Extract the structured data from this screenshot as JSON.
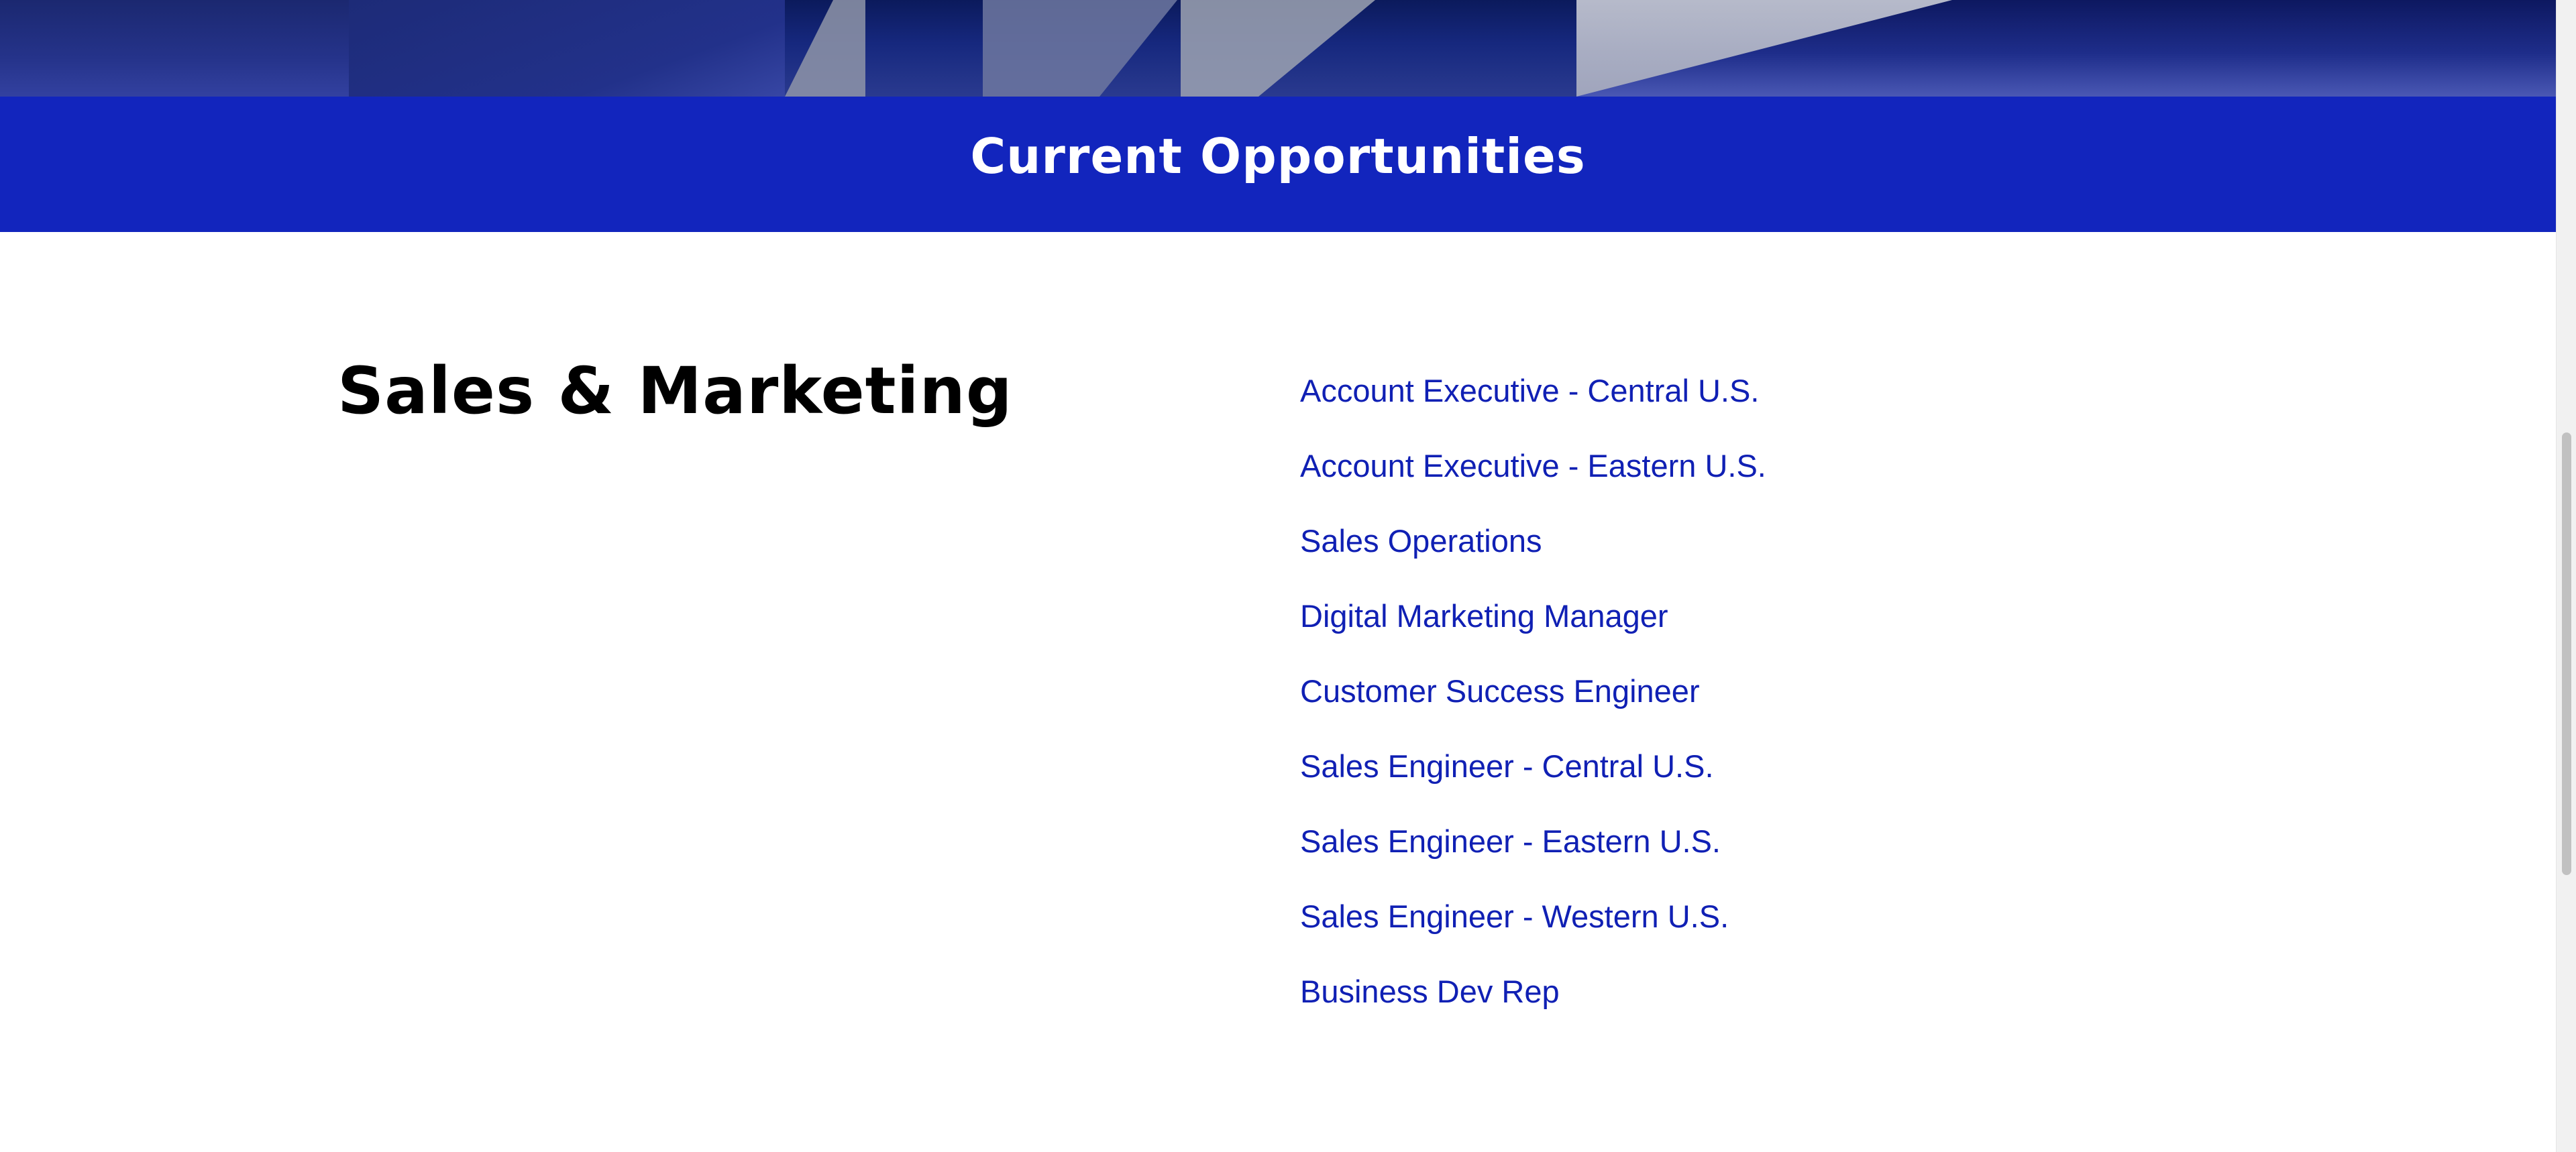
{
  "banner": {
    "title": "Current Opportunities"
  },
  "section": {
    "title": "Sales & Marketing",
    "jobs": [
      "Account Executive - Central U.S.",
      "Account Executive - Eastern U.S.",
      "Sales Operations",
      "Digital Marketing Manager",
      "Customer Success Engineer",
      "Sales Engineer - Central U.S.",
      "Sales Engineer - Eastern U.S.",
      "Sales Engineer - Western U.S.",
      "Business Dev Rep"
    ]
  },
  "colors": {
    "banner_bg": "#1225bd",
    "link": "#1020b4",
    "heading": "#000000"
  }
}
